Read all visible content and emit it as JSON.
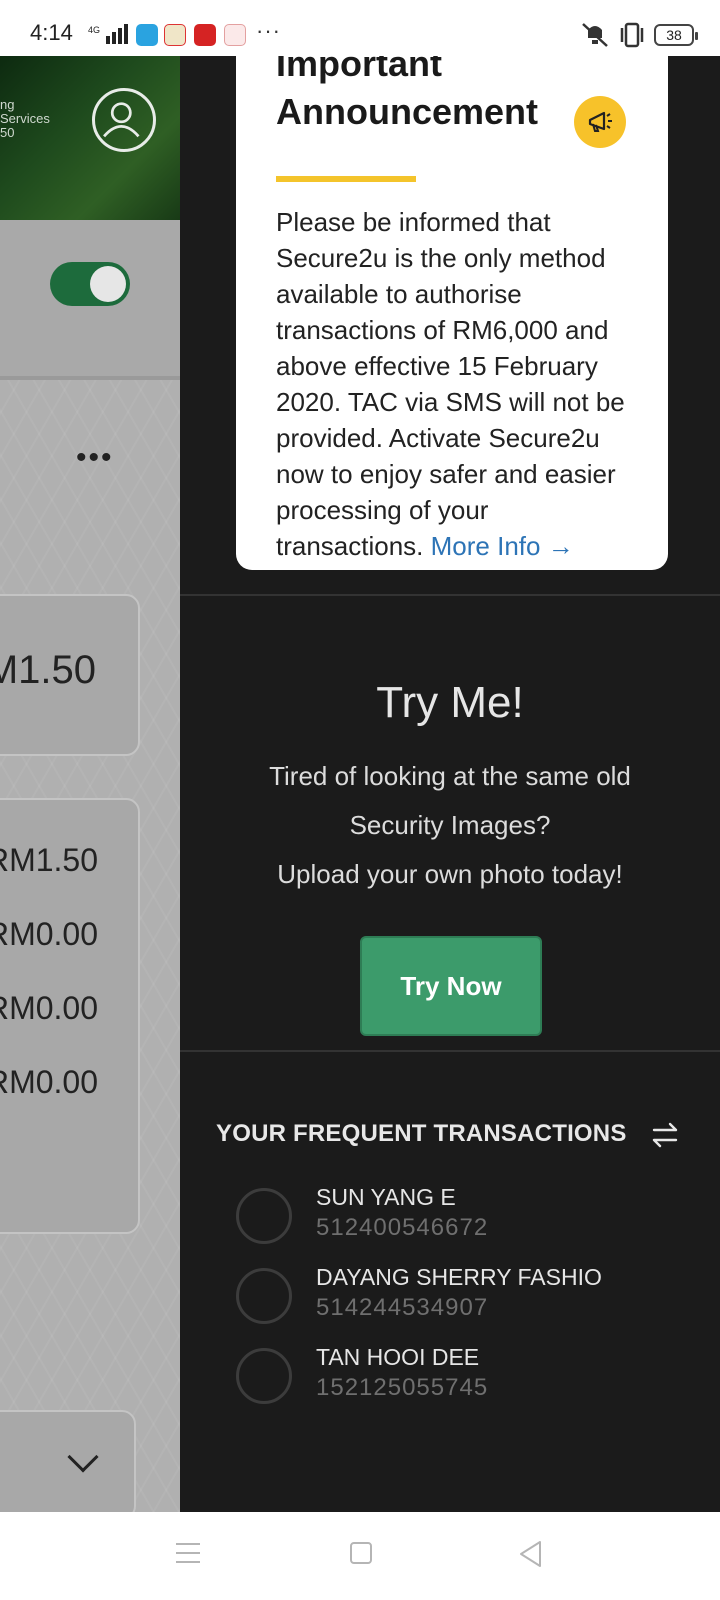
{
  "status_bar": {
    "time": "4:14",
    "network": "4G",
    "more": "···",
    "battery": "38"
  },
  "left_panel": {
    "hero_text_lines": [
      "ng",
      "Services",
      "50"
    ],
    "amount_card": "M1.50",
    "amount_rows": [
      "RM1.50",
      "RM0.00",
      "RM0.00",
      "RM0.00"
    ]
  },
  "announcement": {
    "title": "Important Announcement",
    "body": "Please be informed that Secure2u is the only method available to authorise transactions of RM6,000 and above effective 15 February 2020. TAC via SMS will not be provided. Activate Secure2u now to enjoy safer and easier processing of your transactions.",
    "more_link": "More Info →",
    "accent_color": "#f4c42b"
  },
  "try_me": {
    "title": "Try Me!",
    "line1": "Tired of looking at the same old",
    "line2": "Security Images?",
    "line3": "Upload your own photo today!",
    "button_label": "Try Now",
    "button_color": "#3c9b6b"
  },
  "frequent": {
    "title": "YOUR FREQUENT TRANSACTIONS",
    "icon": "swap-icon",
    "items": [
      {
        "name": "SUN YANG E",
        "account": "512400546672"
      },
      {
        "name": "DAYANG SHERRY FASHIO",
        "account": "514244534907"
      },
      {
        "name": "TAN HOOI DEE",
        "account": "152125055745"
      }
    ]
  }
}
